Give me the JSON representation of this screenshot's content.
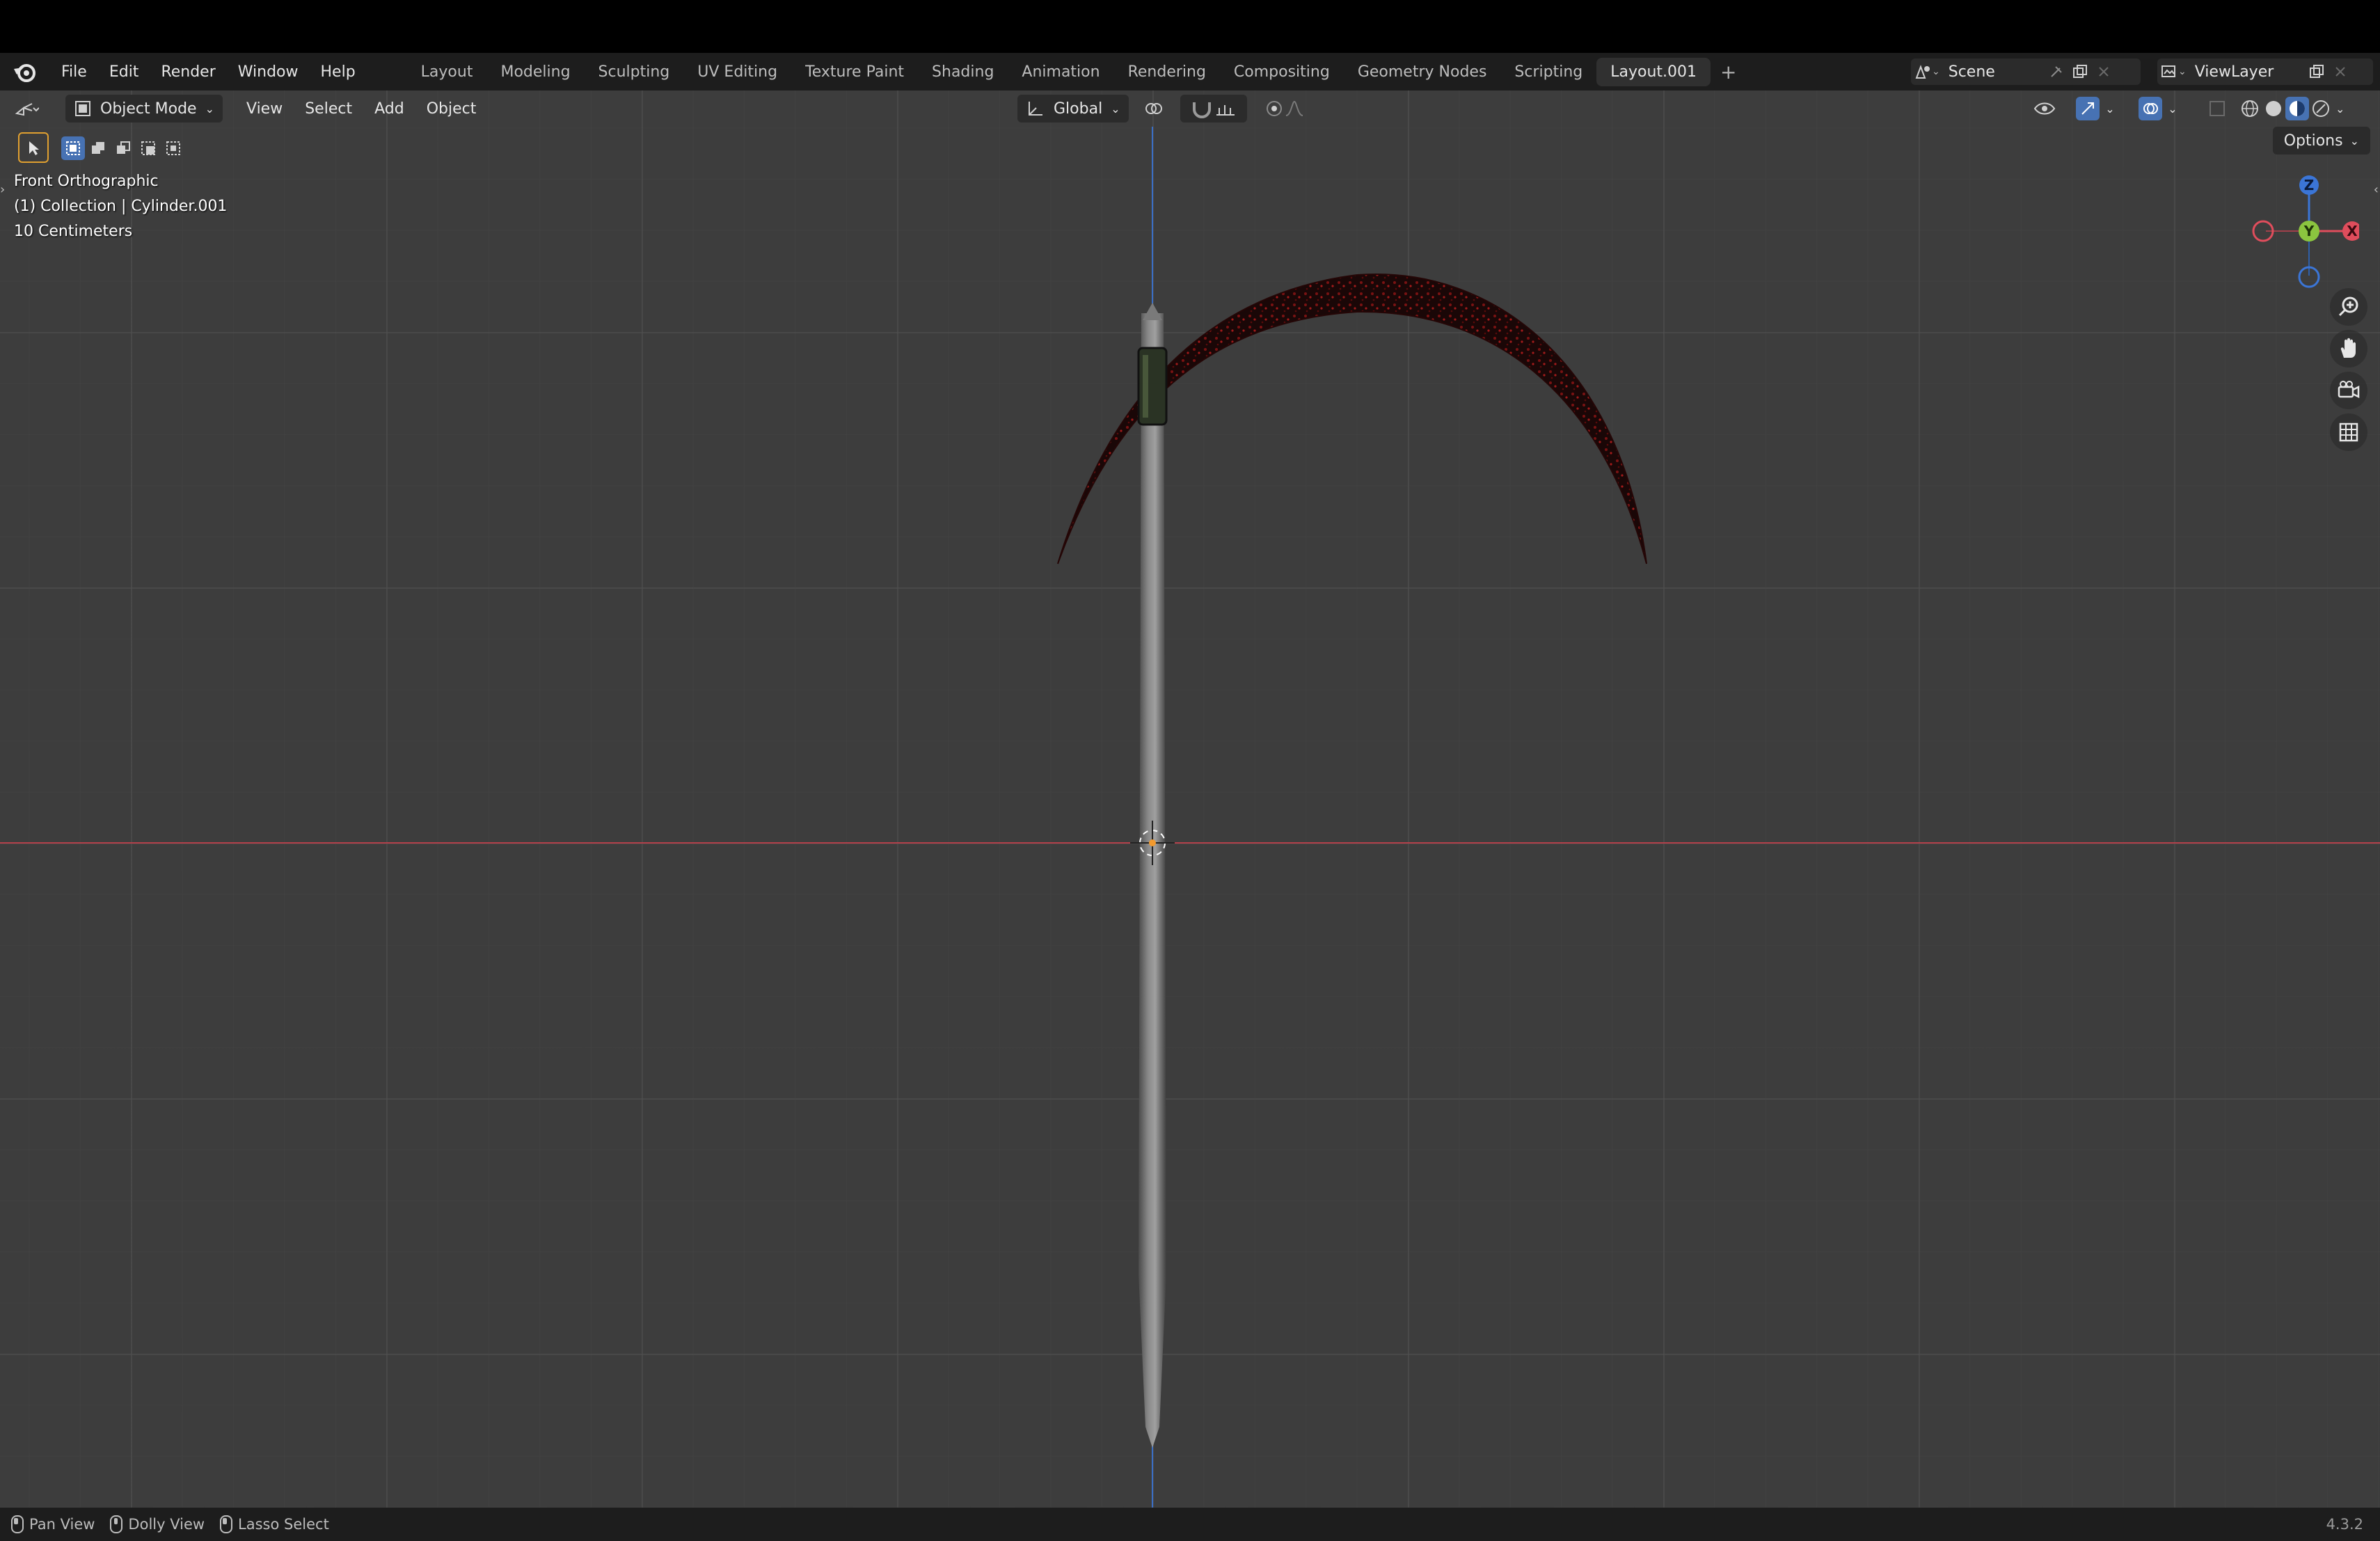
{
  "app": {
    "name": "Blender",
    "version": "4.3.2"
  },
  "menus": [
    "File",
    "Edit",
    "Render",
    "Window",
    "Help"
  ],
  "workspaces": [
    {
      "label": "Layout",
      "active": false
    },
    {
      "label": "Modeling",
      "active": false
    },
    {
      "label": "Sculpting",
      "active": false
    },
    {
      "label": "UV Editing",
      "active": false
    },
    {
      "label": "Texture Paint",
      "active": false
    },
    {
      "label": "Shading",
      "active": false
    },
    {
      "label": "Animation",
      "active": false
    },
    {
      "label": "Rendering",
      "active": false
    },
    {
      "label": "Compositing",
      "active": false
    },
    {
      "label": "Geometry Nodes",
      "active": false
    },
    {
      "label": "Scripting",
      "active": false
    },
    {
      "label": "Layout.001",
      "active": true
    }
  ],
  "scene": {
    "label": "Scene"
  },
  "view_layer": {
    "label": "ViewLayer"
  },
  "viewport_header": {
    "mode": "Object Mode",
    "menus": [
      "View",
      "Select",
      "Add",
      "Object"
    ],
    "orientation": "Global"
  },
  "viewport_overlay": {
    "view_name": "Front Orthographic",
    "collection_info": "(1) Collection | Cylinder.001",
    "scale": "10 Centimeters"
  },
  "options_label": "Options",
  "gizmo": {
    "z": "Z",
    "y": "Y",
    "x": "X"
  },
  "status_bar": {
    "items": [
      "Pan View",
      "Dolly View",
      "Lasso Select"
    ]
  },
  "colors": {
    "accent_blue": "#4772b3",
    "axis_red": "#e04d5c",
    "axis_green": "#8bc53f",
    "axis_blue": "#3b75d6",
    "blade_red": "#6e0f0f"
  }
}
